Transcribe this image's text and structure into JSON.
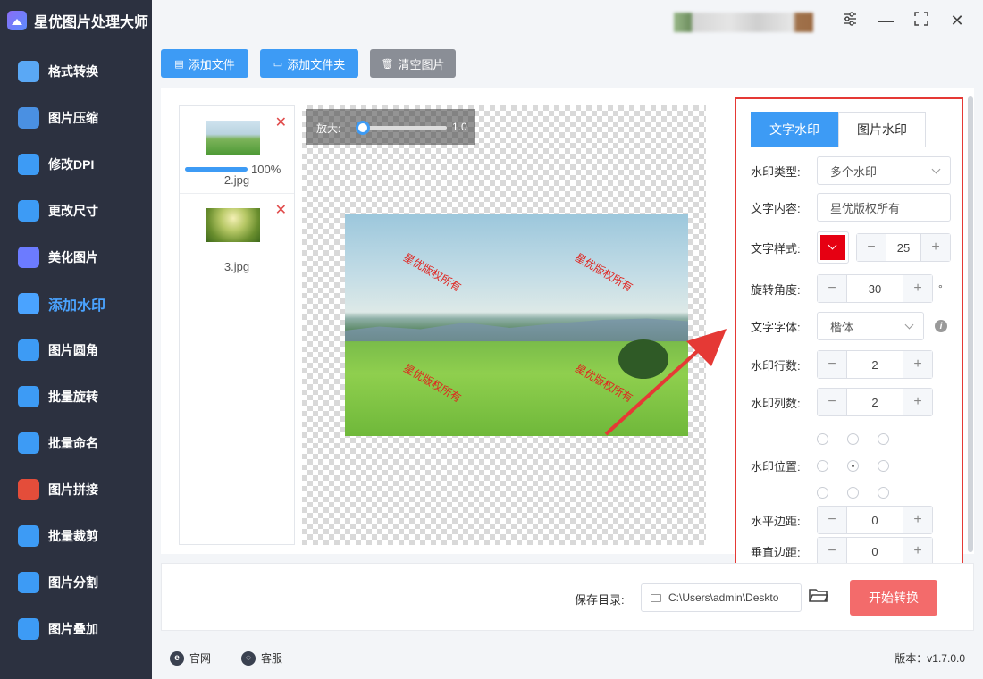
{
  "app": {
    "title": "星优图片处理大师"
  },
  "sidebar": {
    "items": [
      {
        "label": "格式转换",
        "icon": "format-convert-icon",
        "color": "#5aa8f5"
      },
      {
        "label": "图片压缩",
        "icon": "compress-icon",
        "color": "#4a90e2"
      },
      {
        "label": "修改DPI",
        "icon": "dpi-icon",
        "color": "#3d9bf5"
      },
      {
        "label": "更改尺寸",
        "icon": "resize-icon",
        "color": "#3d9bf5"
      },
      {
        "label": "美化图片",
        "icon": "beautify-icon",
        "color": "#6c7bff"
      },
      {
        "label": "添加水印",
        "icon": "watermark-icon",
        "color": "#4aa3ff",
        "active": true
      },
      {
        "label": "图片圆角",
        "icon": "rounded-corner-icon",
        "color": "#3d9bf5"
      },
      {
        "label": "批量旋转",
        "icon": "rotate-icon",
        "color": "#3d9bf5"
      },
      {
        "label": "批量命名",
        "icon": "rename-icon",
        "color": "#3d9bf5"
      },
      {
        "label": "图片拼接",
        "icon": "stitch-icon",
        "color": "#e44d3a"
      },
      {
        "label": "批量裁剪",
        "icon": "crop-icon",
        "color": "#3d9bf5"
      },
      {
        "label": "图片分割",
        "icon": "split-icon",
        "color": "#3d9bf5"
      },
      {
        "label": "图片叠加",
        "icon": "overlay-icon",
        "color": "#3d9bf5"
      }
    ]
  },
  "toolbar": {
    "add_file": "添加文件",
    "add_folder": "添加文件夹",
    "clear": "清空图片"
  },
  "files": [
    {
      "name": "2.jpg",
      "progress": 100,
      "progress_text": "100%"
    },
    {
      "name": "3.jpg"
    }
  ],
  "preview": {
    "zoom_label": "放大:",
    "zoom_value": "1.0",
    "watermark_text": "星优版权所有"
  },
  "panel": {
    "tabs": [
      "文字水印",
      "图片水印"
    ],
    "type_label": "水印类型:",
    "type_value": "多个水印",
    "content_label": "文字内容:",
    "content_value": "星优版权所有",
    "style_label": "文字样式:",
    "style_color": "#e60012",
    "font_size": "25",
    "rotate_label": "旋转角度:",
    "rotate_value": "30",
    "rotate_unit": "°",
    "font_label": "文字字体:",
    "font_value": "楷体",
    "rows_label": "水印行数:",
    "rows_value": "2",
    "cols_label": "水印列数:",
    "cols_value": "2",
    "position_label": "水印位置:",
    "h_margin_label": "水平边距:",
    "h_margin_value": "0",
    "v_margin_label": "垂直边距:",
    "v_margin_value": "0"
  },
  "bottom": {
    "save_label": "保存目录:",
    "save_path": "C:\\Users\\admin\\Deskto",
    "start": "开始转换"
  },
  "footer": {
    "official": "官网",
    "service": "客服",
    "version": "版本：v1.7.0.0"
  }
}
